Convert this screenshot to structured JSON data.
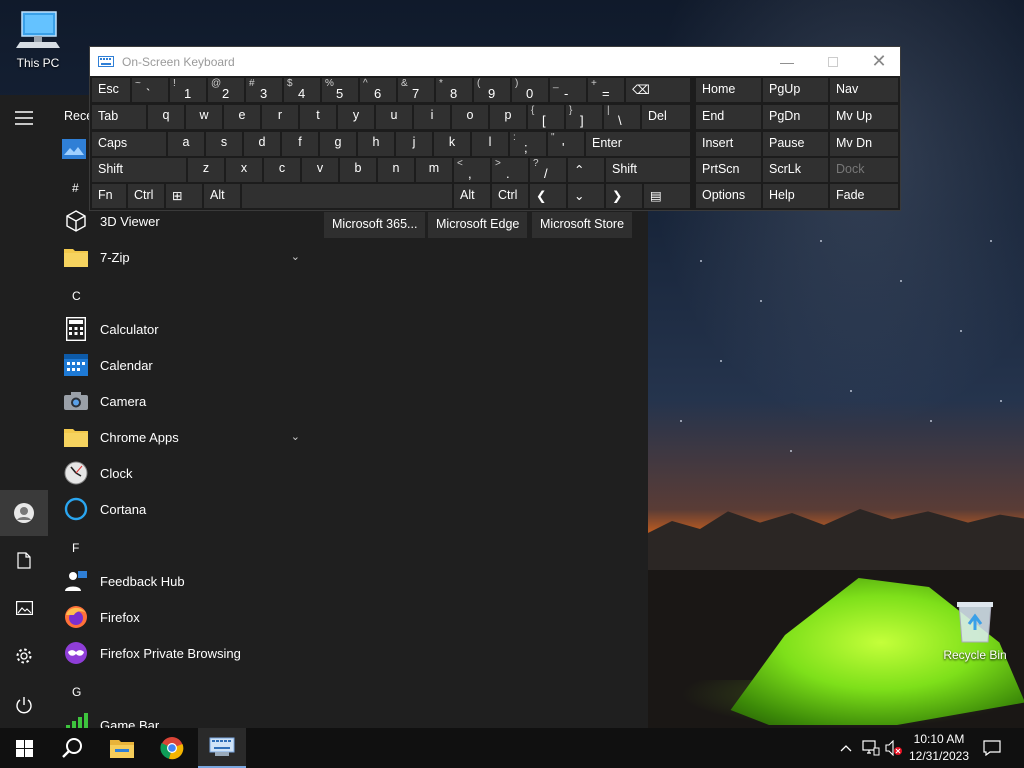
{
  "desktop": {
    "icons": [
      {
        "label": "This PC",
        "icon": "this-pc-icon"
      },
      {
        "label": "Recycle Bin",
        "icon": "recycle-bin-icon"
      }
    ]
  },
  "start_menu": {
    "recent_header": "Rece",
    "rail": [
      "hamburger-menu-icon",
      "user-account-icon",
      "documents-icon",
      "pictures-icon",
      "settings-icon",
      "power-icon"
    ],
    "apps": [
      {
        "section": "#"
      },
      {
        "label": "3D Viewer",
        "icon": "3d-viewer-icon"
      },
      {
        "label": "7-Zip",
        "icon": "folder-icon",
        "expandable": true
      },
      {
        "section": "C"
      },
      {
        "label": "Calculator",
        "icon": "calculator-icon"
      },
      {
        "label": "Calendar",
        "icon": "calendar-icon"
      },
      {
        "label": "Camera",
        "icon": "camera-icon"
      },
      {
        "label": "Chrome Apps",
        "icon": "folder-icon",
        "expandable": true
      },
      {
        "label": "Clock",
        "icon": "clock-icon"
      },
      {
        "label": "Cortana",
        "icon": "cortana-icon"
      },
      {
        "section": "F"
      },
      {
        "label": "Feedback Hub",
        "icon": "feedback-hub-icon"
      },
      {
        "label": "Firefox",
        "icon": "firefox-icon"
      },
      {
        "label": "Firefox Private Browsing",
        "icon": "firefox-private-icon"
      },
      {
        "section": "G"
      },
      {
        "label": "Game Bar",
        "icon": "game-bar-icon"
      }
    ],
    "tiles": [
      "Microsoft 365...",
      "Microsoft Edge",
      "Microsoft Store"
    ]
  },
  "osk": {
    "title": "On-Screen Keyboard",
    "window_controls": [
      "minimize-icon",
      "maximize-icon",
      "close-icon"
    ],
    "keys": {
      "esc": "Esc",
      "tab": "Tab",
      "caps": "Caps",
      "shift": "Shift",
      "fn": "Fn",
      "ctrl": "Ctrl",
      "alt": "Alt",
      "del": "Del",
      "enter": "Enter",
      "home": "Home",
      "pgup": "PgUp",
      "nav": "Nav",
      "end": "End",
      "pgdn": "PgDn",
      "mvup": "Mv Up",
      "insert": "Insert",
      "pause": "Pause",
      "mvdn": "Mv Dn",
      "prtscn": "PrtScn",
      "scrlk": "ScrLk",
      "dock": "Dock",
      "options": "Options",
      "help": "Help",
      "fade": "Fade",
      "row1": [
        {
          "s": "~",
          "b": "`"
        },
        {
          "s": "!",
          "b": "1"
        },
        {
          "s": "@",
          "b": "2"
        },
        {
          "s": "#",
          "b": "3"
        },
        {
          "s": "$",
          "b": "4"
        },
        {
          "s": "%",
          "b": "5"
        },
        {
          "s": "^",
          "b": "6"
        },
        {
          "s": "&",
          "b": "7"
        },
        {
          "s": "*",
          "b": "8"
        },
        {
          "s": "(",
          "b": "9"
        },
        {
          "s": ")",
          "b": "0"
        },
        {
          "s": "_",
          "b": "-"
        },
        {
          "s": "+",
          "b": "="
        }
      ],
      "row2": [
        "q",
        "w",
        "e",
        "r",
        "t",
        "y",
        "u",
        "i",
        "o",
        "p"
      ],
      "row2_sym": [
        {
          "s": "{",
          "b": "["
        },
        {
          "s": "}",
          "b": "]"
        },
        {
          "s": "|",
          "b": "\\"
        }
      ],
      "row3": [
        "a",
        "s",
        "d",
        "f",
        "g",
        "h",
        "j",
        "k",
        "l"
      ],
      "row3_sym": [
        {
          "s": ":",
          "b": ";"
        },
        {
          "s": "\"",
          "b": "'"
        }
      ],
      "row4": [
        "z",
        "x",
        "c",
        "v",
        "b",
        "n",
        "m"
      ],
      "row4_sym": [
        {
          "s": "<",
          "b": ","
        },
        {
          "s": ">",
          "b": "."
        },
        {
          "s": "?",
          "b": "/"
        }
      ]
    }
  },
  "taskbar": {
    "buttons": [
      "start-icon",
      "search-icon",
      "file-explorer-icon",
      "chrome-icon",
      "on-screen-keyboard-icon"
    ],
    "time": "10:10 AM",
    "date": "12/31/2023"
  }
}
